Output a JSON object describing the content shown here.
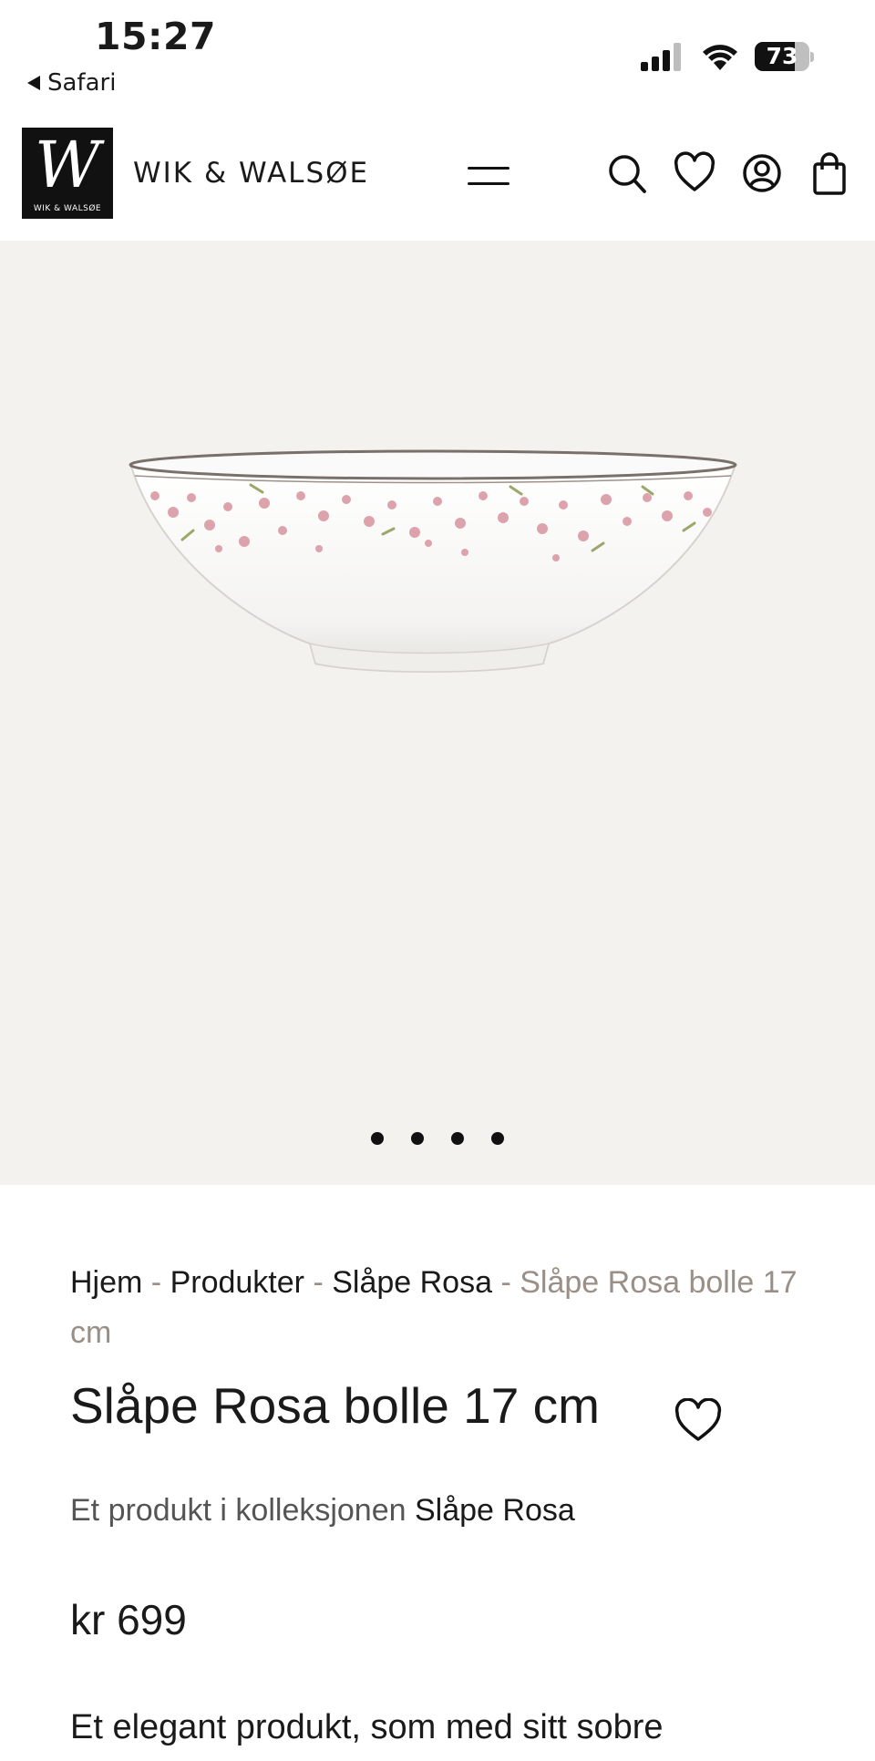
{
  "status_bar": {
    "time": "15:27",
    "back_label": "Safari",
    "battery_percent": "73",
    "battery_level": 0.73
  },
  "header": {
    "logo_letter": "W",
    "logo_small_text": "WIK & WALSØE",
    "brand": "WIK & WALSØE",
    "icons": [
      "menu-icon",
      "search-icon",
      "heart-icon",
      "account-icon",
      "bag-icon"
    ]
  },
  "gallery": {
    "slide_count": 4,
    "background": "#f3f2ef"
  },
  "breadcrumb": {
    "items": [
      "Hjem",
      "Produkter",
      "Slåpe Rosa"
    ],
    "separator": "-",
    "current": "Slåpe Rosa bolle 17 cm"
  },
  "product": {
    "title": "Slåpe Rosa bolle 17 cm",
    "collection_prefix": "Et produkt i kolleksjonen",
    "collection_name": "Slåpe Rosa",
    "price": "kr 699",
    "description": "Et elegant produkt, som med sitt sobre"
  },
  "colors": {
    "accent_muted": "#9a8f86",
    "text": "#1a1a1a"
  }
}
